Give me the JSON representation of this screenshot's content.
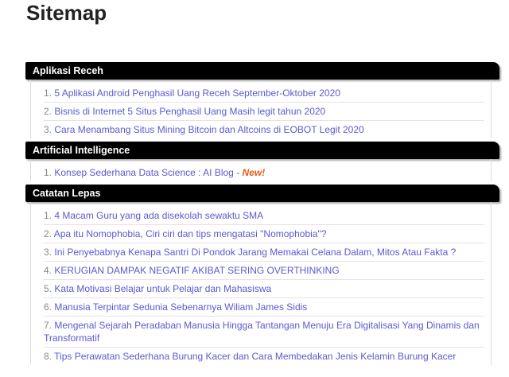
{
  "page": {
    "title": "Sitemap"
  },
  "sections": [
    {
      "title": "Aplikasi Receh",
      "items": [
        {
          "num": "1.",
          "text": "5 Aplikasi Android Penghasil Uang Receh September-Oktober 2020"
        },
        {
          "num": "2.",
          "text": "Bisnis di Internet 5 Situs Penghasil Uang Masih legit tahun 2020"
        },
        {
          "num": "3.",
          "text": "Cara Menambang Situs Mining Bitcoin dan Altcoins di EOBOT Legit 2020"
        }
      ]
    },
    {
      "title": "Artificial Intelligence",
      "items": [
        {
          "num": "1.",
          "text": "Konsep Sederhana Data Science : AI Blog",
          "sep": " - ",
          "badge": "New!"
        }
      ]
    },
    {
      "title": "Catatan Lepas",
      "items": [
        {
          "num": "1.",
          "text": "4 Macam Guru yang ada disekolah sewaktu SMA"
        },
        {
          "num": "2.",
          "text": "Apa itu Nomophobia, Ciri ciri dan tips mengatasi \"Nomophobia\"?"
        },
        {
          "num": "3.",
          "text": "Ini Penyebabnya Kenapa Santri Di Pondok Jarang Memakai Celana Dalam, Mitos Atau Fakta ?"
        },
        {
          "num": "4.",
          "text": "KERUGIAN DAMPAK NEGATIF AKIBAT SERING OVERTHINKING"
        },
        {
          "num": "5.",
          "text": "Kata Motivasi Belajar untuk Pelajar dan Mahasiswa"
        },
        {
          "num": "6.",
          "text": "Manusia Terpintar Sedunia Sebenarnya Wiliam James Sidis"
        },
        {
          "num": "7.",
          "text": "Mengenal Sejarah Peradaban Manusia Hingga Tantangan Menuju Era Digitalisasi Yang Dinamis dan Transformatif"
        },
        {
          "num": "8.",
          "text": "Tips Perawatan Sederhana Burung Kacer dan Cara Membedakan Jenis Kelamin Burung Kacer"
        }
      ]
    }
  ]
}
